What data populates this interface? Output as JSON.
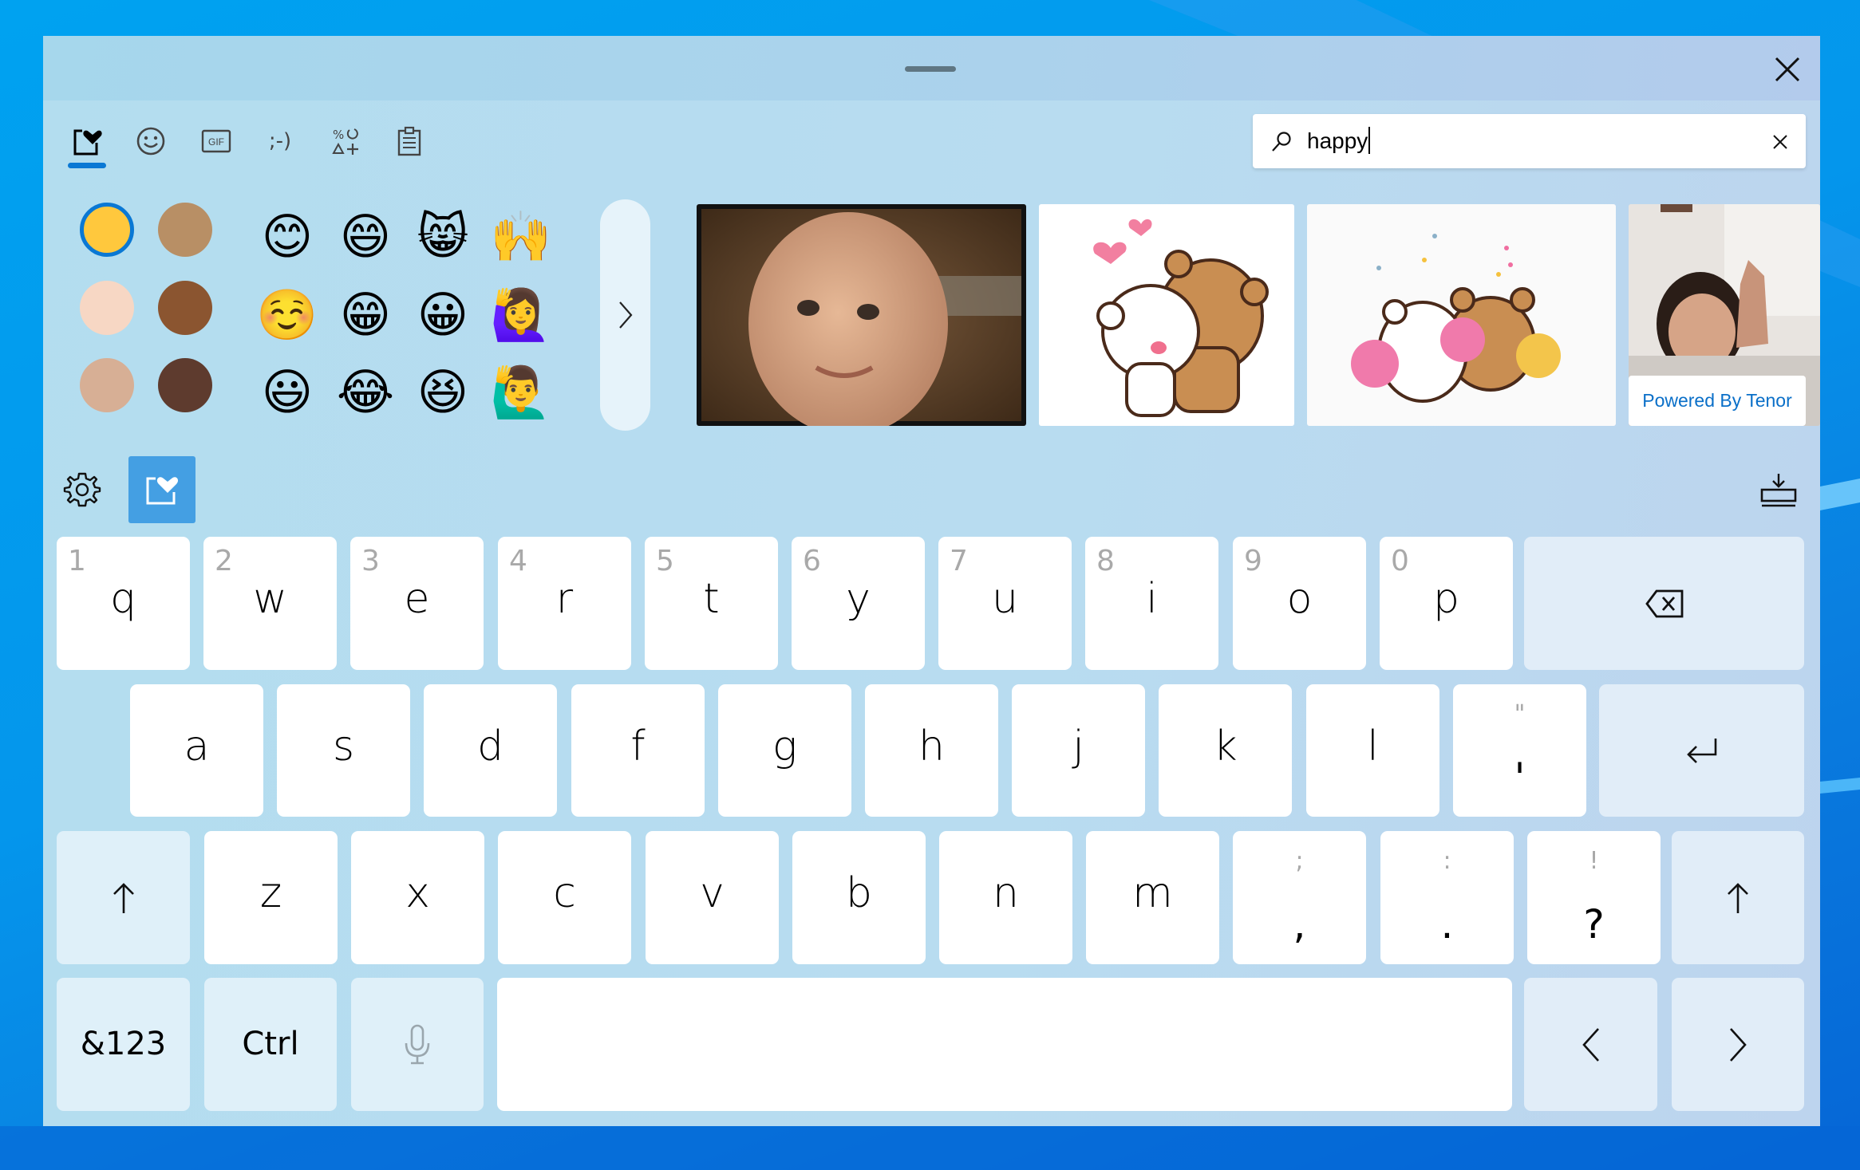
{
  "window": {
    "title_handle": "drag-handle",
    "close_label": "Close"
  },
  "tabs": [
    {
      "id": "favorites",
      "label": "Most recently used",
      "icon": "heart-box-icon",
      "selected": true
    },
    {
      "id": "emoji",
      "label": "Emoji",
      "icon": "smiley-icon",
      "selected": false
    },
    {
      "id": "gif",
      "label": "GIF",
      "icon": "gif-icon",
      "selected": false
    },
    {
      "id": "kaomoji",
      "label": ";-)",
      "icon": "kaomoji-icon",
      "selected": false
    },
    {
      "id": "symbols",
      "label": "Symbols",
      "icon": "symbols-icon",
      "selected": false
    },
    {
      "id": "clipboard",
      "label": "Clipboard",
      "icon": "clipboard-icon",
      "selected": false
    }
  ],
  "search": {
    "value": "happy",
    "placeholder": "Search",
    "clear_label": "Clear"
  },
  "skin_tones": [
    {
      "name": "default",
      "color": "#FFC83D",
      "selected": true
    },
    {
      "name": "medium",
      "color": "#B88F65",
      "selected": false
    },
    {
      "name": "light",
      "color": "#F7D7C4",
      "selected": false
    },
    {
      "name": "medium-dark",
      "color": "#8B5530",
      "selected": false
    },
    {
      "name": "medium-light",
      "color": "#D7AF95",
      "selected": false
    },
    {
      "name": "dark",
      "color": "#5E3B2E",
      "selected": false
    }
  ],
  "emoji_results": [
    {
      "char": "😊",
      "name": "smiling-face-with-smiling-eyes"
    },
    {
      "char": "😄",
      "name": "grinning-face-with-smiling-eyes"
    },
    {
      "char": "😸",
      "name": "grinning-cat-with-smiling-eyes"
    },
    {
      "char": "🙌",
      "name": "raising-hands"
    },
    {
      "char": "☺️",
      "name": "smiling-face"
    },
    {
      "char": "😁",
      "name": "beaming-face-with-smiling-eyes"
    },
    {
      "char": "😀",
      "name": "grinning-face"
    },
    {
      "char": "🙋‍♀️",
      "name": "woman-raising-hand"
    },
    {
      "char": "😃",
      "name": "grinning-face-with-big-eyes"
    },
    {
      "char": "😂",
      "name": "face-with-tears-of-joy"
    },
    {
      "char": "😆",
      "name": "grinning-squinting-face"
    },
    {
      "char": "🙋‍♂️",
      "name": "man-raising-hand"
    }
  ],
  "gif_results": [
    {
      "name": "baby-smiling-gif"
    },
    {
      "name": "bears-hugging-gif"
    },
    {
      "name": "bears-cheering-gif"
    },
    {
      "name": "girl-thumbs-up-gif"
    }
  ],
  "tenor_label": "Powered By Tenor",
  "toolbar": {
    "settings_label": "Settings",
    "favorites_label": "Emoji panel",
    "dock_label": "Dock keyboard"
  },
  "keyboard": {
    "row1": [
      {
        "main": "q",
        "sec": "1"
      },
      {
        "main": "w",
        "sec": "2"
      },
      {
        "main": "e",
        "sec": "3"
      },
      {
        "main": "r",
        "sec": "4"
      },
      {
        "main": "t",
        "sec": "5"
      },
      {
        "main": "y",
        "sec": "6"
      },
      {
        "main": "u",
        "sec": "7"
      },
      {
        "main": "i",
        "sec": "8"
      },
      {
        "main": "o",
        "sec": "9"
      },
      {
        "main": "p",
        "sec": "0"
      }
    ],
    "row2": [
      {
        "main": "a"
      },
      {
        "main": "s"
      },
      {
        "main": "d"
      },
      {
        "main": "f"
      },
      {
        "main": "g"
      },
      {
        "main": "h"
      },
      {
        "main": "j"
      },
      {
        "main": "k"
      },
      {
        "main": "l"
      },
      {
        "main": "'",
        "sec": "\""
      }
    ],
    "row3": [
      {
        "main": "z"
      },
      {
        "main": "x"
      },
      {
        "main": "c"
      },
      {
        "main": "v"
      },
      {
        "main": "b"
      },
      {
        "main": "n"
      },
      {
        "main": "m"
      },
      {
        "main": ",",
        "sec": ";"
      },
      {
        "main": ".",
        "sec": ":"
      },
      {
        "main": "?",
        "sec": "!"
      }
    ],
    "backspace": "Backspace",
    "enter": "Enter",
    "shift": "Shift",
    "symbols_label": "&123",
    "ctrl_label": "Ctrl",
    "mic_label": "Dictation",
    "space_label": "",
    "left_label": "Left",
    "right_label": "Right"
  },
  "colors": {
    "accent": "#0A78D4",
    "panel_bg": "#B3DDEF",
    "tenor_text": "#0A6FC8",
    "fav_button": "#449FE3"
  }
}
